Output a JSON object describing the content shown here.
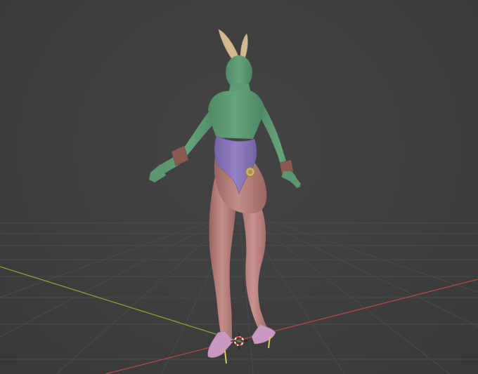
{
  "viewport": {
    "mode": "3d-viewport",
    "shading": "solid",
    "colors": {
      "background": "#3d3d3d",
      "grid_line": "#4a4a4a",
      "x_axis": "#b04848",
      "y_axis": "#7fa83a",
      "skin_upper": "#62a078",
      "suit": "#8a78b8",
      "tights": "#b87c78",
      "cuffs": "#8a5a50",
      "ears": "#d4b890",
      "heels": "#c898c0",
      "tail": "#c8b070",
      "cursor_ring": "#e05030"
    }
  },
  "objects": [
    {
      "name": "character-mesh",
      "icon": "mesh-icon"
    },
    {
      "name": "3d-cursor",
      "icon": "crosshair-icon"
    }
  ]
}
